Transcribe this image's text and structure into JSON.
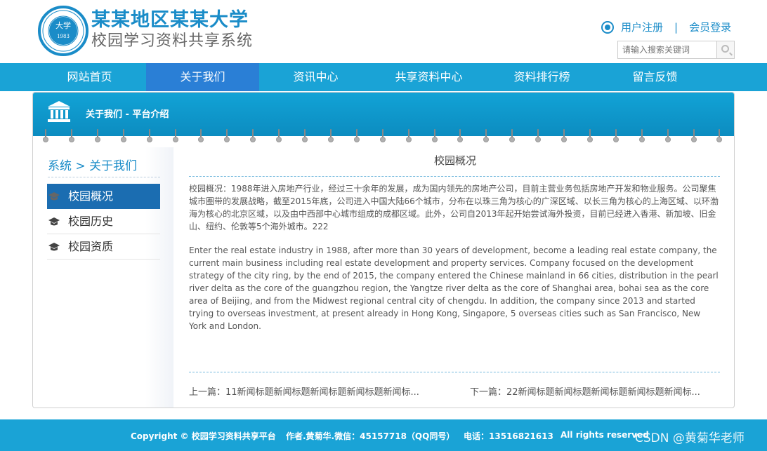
{
  "header": {
    "logo_text": "大学",
    "logo_ring_top": "SHENZHEN UNIVERSITY",
    "logo_year": "1983",
    "title": "某某地区某某大学",
    "subtitle": "校园学习资料共享系统",
    "register": "用户注册",
    "separator": "|",
    "login": "会员登录",
    "search_placeholder": "请输入搜索关键词"
  },
  "nav": {
    "items": [
      {
        "label": "网站首页",
        "active": false
      },
      {
        "label": "关于我们",
        "active": true
      },
      {
        "label": "资讯中心",
        "active": false
      },
      {
        "label": "共享资料中心",
        "active": false
      },
      {
        "label": "资料排行榜",
        "active": false
      },
      {
        "label": "留言反馈",
        "active": false
      }
    ]
  },
  "banner": {
    "text": "关于我们 - 平台介绍",
    "icon": "bank-icon"
  },
  "sidebar": {
    "title": "系统 > 关于我们",
    "items": [
      {
        "label": "校园概况",
        "active": true,
        "icon": "graduation-cap-icon"
      },
      {
        "label": "校园历史",
        "active": false,
        "icon": "graduation-cap-icon"
      },
      {
        "label": "校园资质",
        "active": false,
        "icon": "graduation-cap-icon"
      }
    ]
  },
  "content": {
    "title": "校园概况",
    "paragraph_cn": "校园概况：1988年进入房地产行业，经过三十余年的发展，成为国内领先的房地产公司，目前主营业务包括房地产开发和物业服务。公司聚焦城市圈带的发展战略，截至2015年底，公司进入中国大陆66个城市，分布在以珠三角为核心的广深区域、以长三角为核心的上海区域、以环渤海为核心的北京区域，以及由中西部中心城市组成的成都区域。此外，公司自2013年起开始尝试海外投资，目前已经进入香港、新加坡、旧金山、纽约、伦敦等5个海外城市。222",
    "paragraph_en": "Enter the real estate industry in 1988, after more than 30 years of development, become a leading real estate company, the current main business including real estate development and property services. Company focused on the development strategy of the city ring, by the end of 2015, the company entered the Chinese mainland in 66 cities, distribution in the pearl river delta as the core of the guangzhou region, the Yangtze river delta as the core of Shanghai area, bohai sea as the core area of Beijing, and from the Midwest regional central city of chengdu. In addition, the company since 2013 and started trying to overseas investment, at present already in Hong Kong, Singapore, 5 overseas cities such as San Francisco, New York and London.",
    "prev": "上一篇：11新闻标题新闻标题新闻标题新闻标题新闻标...",
    "next": "下一篇：22新闻标题新闻标题新闻标题新闻标题新闻标..."
  },
  "footer": {
    "copyright": "Copyright © 校园学习资料共享平台",
    "author": "作者.黄菊华.微信：45157718（QQ同号）",
    "phone": "电话：13516821613",
    "rights": "All rights reserved",
    "watermark": "CSDN @黄菊华老师"
  },
  "colors": {
    "primary": "#1aa3d6",
    "nav_active": "#2a7fd6",
    "sidebar_active": "#1b6db1",
    "title_blue": "#1a8cc8"
  }
}
